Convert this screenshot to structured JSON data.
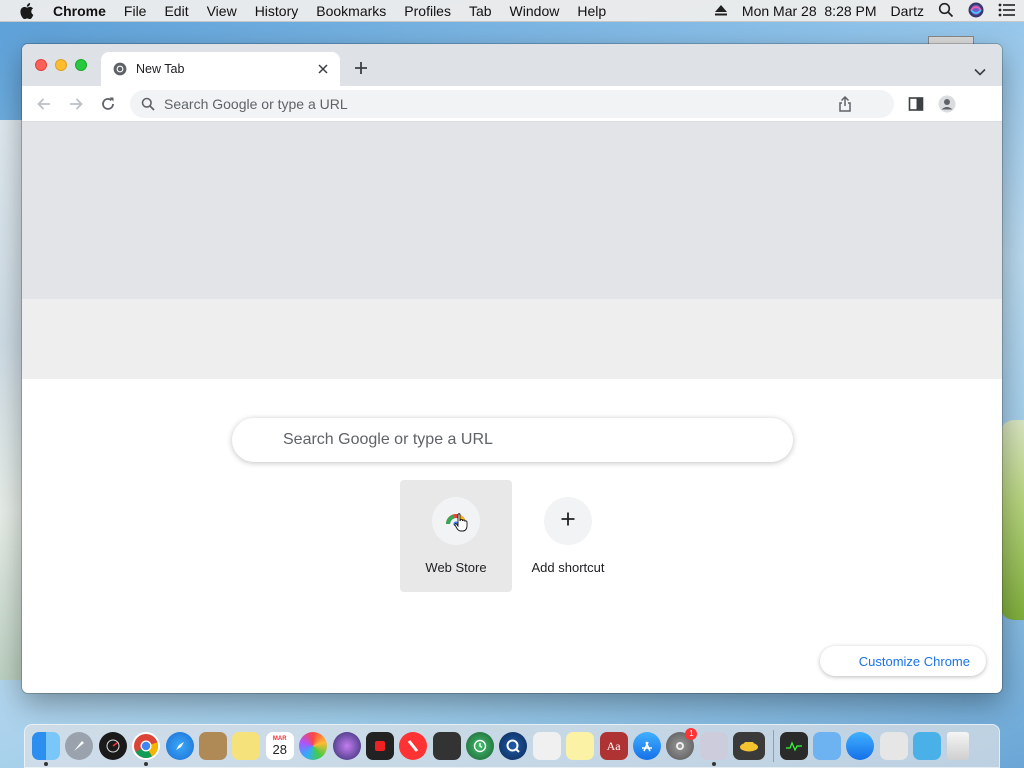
{
  "menubar": {
    "app_name": "Chrome",
    "menus": [
      "File",
      "Edit",
      "View",
      "History",
      "Bookmarks",
      "Profiles",
      "Tab",
      "Window",
      "Help"
    ],
    "clock": "Mon Mar 28  8:28 PM",
    "user": "Dartz"
  },
  "browser": {
    "tab": {
      "title": "New Tab"
    },
    "omnibox": {
      "placeholder": "Search Google or type a URL"
    }
  },
  "newtab": {
    "search_placeholder": "Search Google or type a URL",
    "shortcuts": [
      {
        "label": "Web Store",
        "icon": "chrome-web-store-icon"
      },
      {
        "label": "Add shortcut",
        "icon": "plus-icon"
      }
    ],
    "customize_label": "Customize Chrome"
  },
  "dock": {
    "calendar_day": "28",
    "calendar_month": "MAR",
    "notification_badge": "1",
    "dictionary_label": "Aa"
  },
  "colors": {
    "accent_blue": "#1a73e8",
    "tabstrip": "#dee1e6",
    "hero_top": "#e3e4e7",
    "hero_bottom": "#eeeeef"
  }
}
